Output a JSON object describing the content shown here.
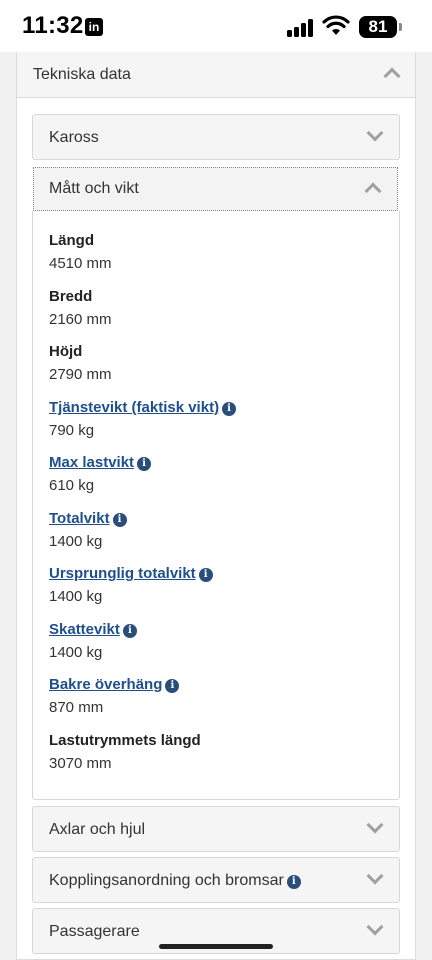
{
  "status_bar": {
    "time": "11:32",
    "notification_app": "in",
    "battery": "81"
  },
  "section": {
    "title": "Tekniska data"
  },
  "panels": {
    "kaross": "Kaross",
    "matt_och_vikt": "Mått och vikt",
    "axlar": "Axlar och hjul",
    "koppling": "Kopplingsanordning och bromsar",
    "passagerare": "Passagerare"
  },
  "specs": [
    {
      "name": "Längd",
      "value": "4510 mm",
      "link": false,
      "info": false
    },
    {
      "name": "Bredd",
      "value": "2160 mm",
      "link": false,
      "info": false
    },
    {
      "name": "Höjd",
      "value": "2790 mm",
      "link": false,
      "info": false
    },
    {
      "name": "Tjänstevikt (faktisk vikt)",
      "value": "790 kg",
      "link": true,
      "info": true
    },
    {
      "name": "Max lastvikt",
      "value": "610 kg",
      "link": true,
      "info": true
    },
    {
      "name": "Totalvikt",
      "value": "1400 kg",
      "link": true,
      "info": true
    },
    {
      "name": "Ursprunglig totalvikt",
      "value": "1400 kg",
      "link": true,
      "info": true
    },
    {
      "name": "Skattevikt",
      "value": "1400 kg",
      "link": true,
      "info": true
    },
    {
      "name": "Bakre överhäng",
      "value": "870 mm",
      "link": true,
      "info": true
    },
    {
      "name": "Lastutrymmets längd",
      "value": "3070 mm",
      "link": false,
      "info": false
    }
  ],
  "icons": {
    "info": "info-circle-icon",
    "expand": "chevron-down-icon",
    "collapse": "chevron-up-icon"
  },
  "colors": {
    "link": "#1f4f8c",
    "info_icon": "#2a4d7a",
    "panel_bg": "#f5f5f5"
  }
}
